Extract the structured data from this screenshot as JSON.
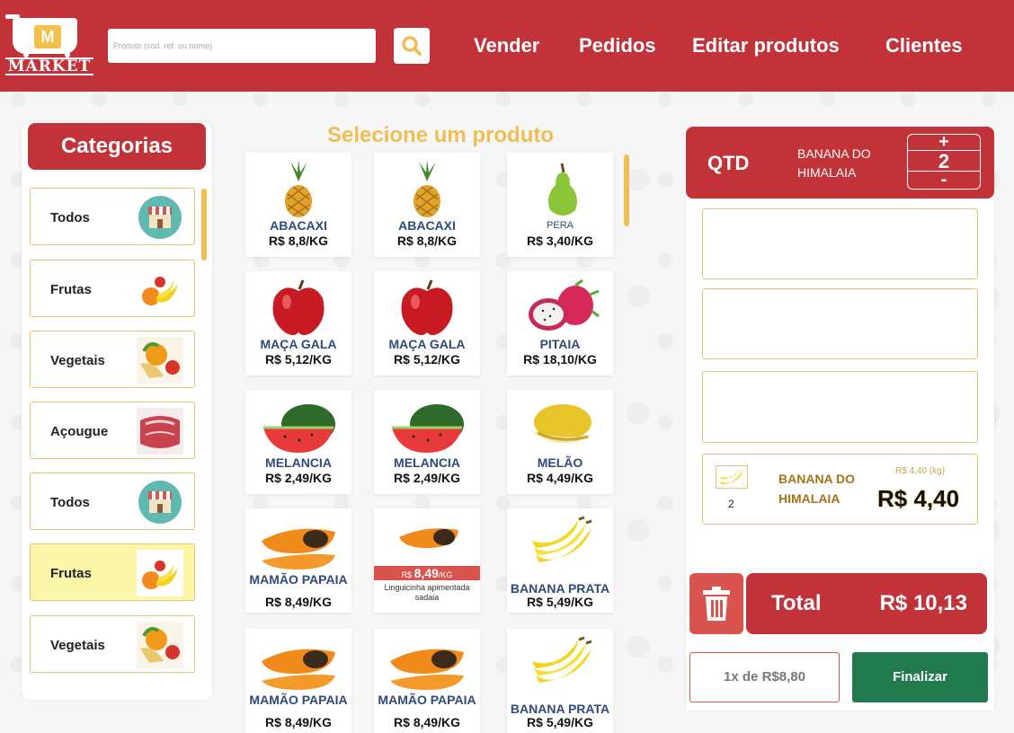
{
  "header": {
    "logo_letter": "M",
    "logo_text": "MARKET",
    "search_placeholder": "Produto (cod. ref. ou nome)",
    "nav": [
      "Vender",
      "Pedidos",
      "Editar produtos",
      "Clientes"
    ]
  },
  "sidebar": {
    "title": "Categorias",
    "items": [
      {
        "label": "Todos",
        "icon": "store-icon"
      },
      {
        "label": "Frutas",
        "icon": "fruits-icon"
      },
      {
        "label": "Vegetais",
        "icon": "vegetables-icon"
      },
      {
        "label": "Açougue",
        "icon": "meat-icon"
      },
      {
        "label": "Todos",
        "icon": "store-icon"
      },
      {
        "label": "Frutas",
        "icon": "fruits-icon",
        "active": true
      },
      {
        "label": "Vegetais",
        "icon": "vegetables-icon"
      }
    ]
  },
  "products": {
    "title": "Selecione um produto",
    "items": [
      {
        "name": "ABACAXI",
        "price": "R$ 8,8/KG",
        "icon": "pineapple-icon"
      },
      {
        "name": "ABACAXI",
        "price": "R$ 8,8/KG",
        "icon": "pineapple-icon"
      },
      {
        "name": "PERA",
        "price": "R$ 3,40/KG",
        "icon": "pear-icon"
      },
      {
        "name": "MAÇA GALA",
        "price": "R$ 5,12/KG",
        "icon": "apple-icon"
      },
      {
        "name": "MAÇA GALA",
        "price": "R$ 5,12/KG",
        "icon": "apple-icon"
      },
      {
        "name": "PITAIA",
        "price": "R$ 18,10/KG",
        "icon": "dragonfruit-icon"
      },
      {
        "name": "MELANCIA",
        "price": "R$ 2,49/KG",
        "icon": "watermelon-icon"
      },
      {
        "name": "MELANCIA",
        "price": "R$ 2,49/KG",
        "icon": "watermelon-icon"
      },
      {
        "name": "MELÃO",
        "price": "R$ 4,49/KG",
        "icon": "melon-icon"
      },
      {
        "name": "MAMÃO PAPAIA",
        "price": "R$ 8,49/KG",
        "icon": "papaya-icon"
      },
      {
        "badge_prefix": "R$",
        "badge_value": "8,49",
        "badge_unit": "/KG",
        "description": "Linguicinha apimentada sadaia",
        "icon": "papaya-icon"
      },
      {
        "name": "BANANA PRATA",
        "price": "R$ 5,49/KG",
        "icon": "banana-icon"
      },
      {
        "name": "MAMÃO PAPAIA",
        "price": "R$ 8,49/KG",
        "icon": "papaya-icon"
      },
      {
        "name": "MAMÃO PAPAIA",
        "price": "R$ 8,49/KG",
        "icon": "papaya-icon"
      },
      {
        "name": "BANANA PRATA",
        "price": "R$ 5,49/KG",
        "icon": "banana-icon"
      }
    ]
  },
  "cart": {
    "qty_label": "QTD",
    "selected_name": "BANANA DO HIMALAIA",
    "qty_plus": "+",
    "qty_value": "2",
    "qty_minus": "-",
    "item": {
      "qty": "2",
      "name": "BANANA DO HIMALAIA",
      "unit_price": "R$ 4,40 (kg)",
      "price": "R$ 4,40"
    },
    "total_label": "Total",
    "total_value": "R$ 10,13",
    "payment_label": "1x de R$8,80",
    "finalize_label": "Finalizar"
  },
  "colors": {
    "brand_red": "#c13338",
    "accent_yellow": "#f1bd55",
    "finalize_green": "#217a4d"
  }
}
